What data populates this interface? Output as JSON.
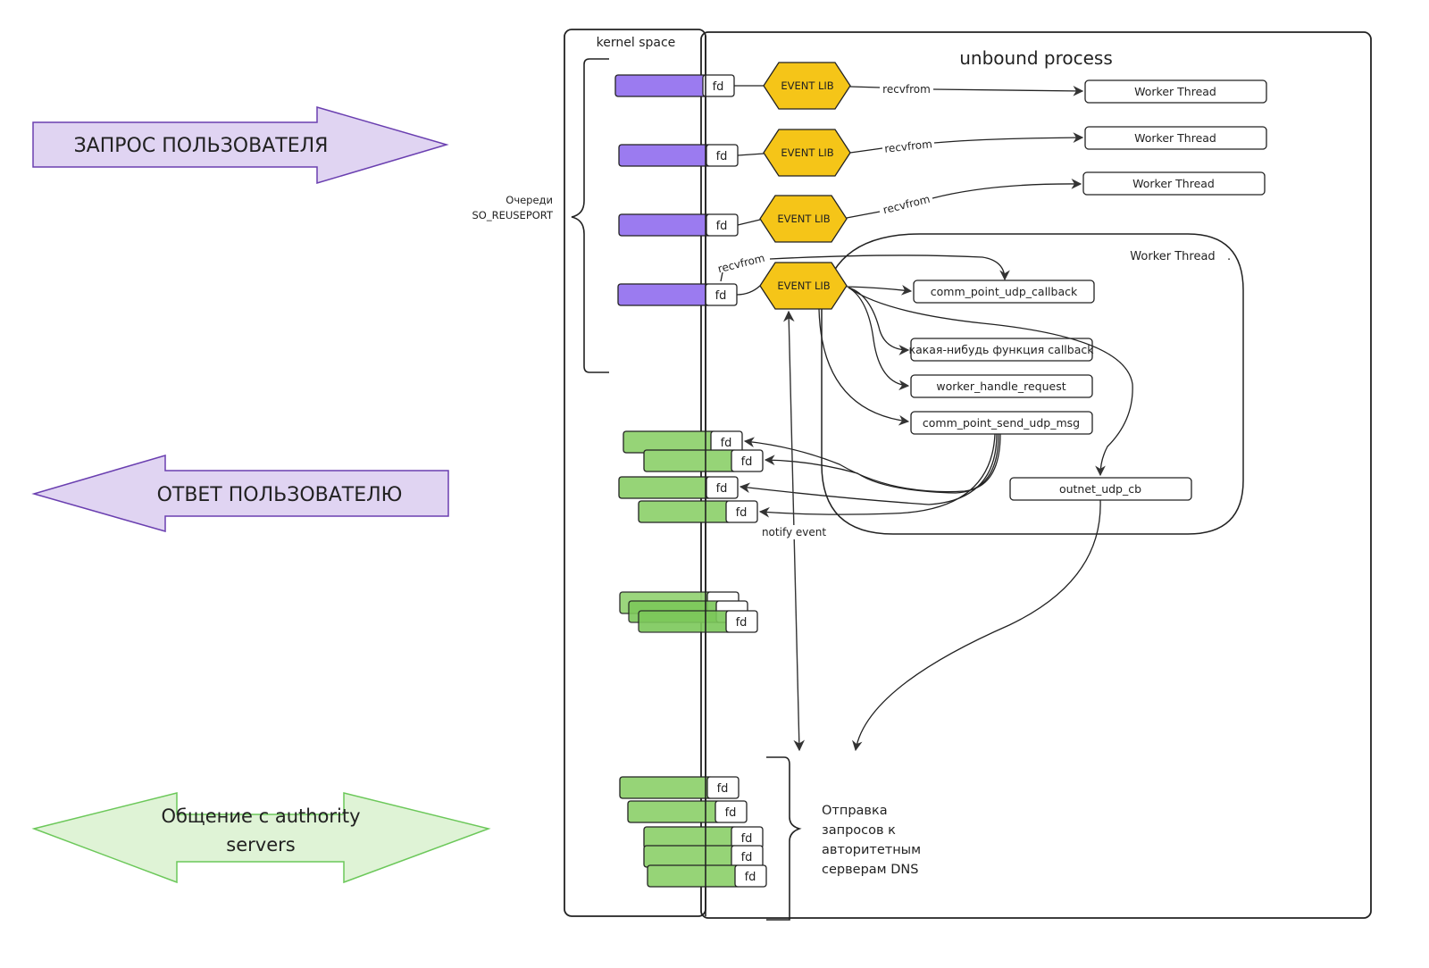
{
  "colors": {
    "queue_purple": "#9b7bf0",
    "request_arrow_fill": "#e0d4f2",
    "request_arrow_stroke": "#6a3fb0",
    "event_lib_fill": "#f5c518",
    "fd_green": "#96d477",
    "authority_arrow_fill": "#dff3d6",
    "authority_arrow_stroke": "#6cc85a",
    "line": "#222222"
  },
  "arrows": {
    "user_request": "ЗАПРОС ПОЛЬЗОВАТЕЛЯ",
    "user_response": "ОТВЕТ ПОЛЬЗОВАТЕЛЮ",
    "authority_line1": "Общение с authority",
    "authority_line2": "servers"
  },
  "kernel": {
    "title": "kernel space",
    "queues_label_line1": "Очереди",
    "queues_label_line2": "SO_REUSEPORT"
  },
  "process": {
    "title": "unbound process",
    "fd_label": "fd",
    "event_lib": "EVENT LIB",
    "recvfrom": "recvfrom",
    "worker_thread": "Worker Thread",
    "inner_worker_title": "Worker Thread",
    "inner_worker_dot": ".",
    "functions": {
      "udp_callback": "comm_point_udp_callback",
      "any_callback": "какая-нибудь функция callback",
      "handle_request": "worker_handle_request",
      "send_udp_msg": "comm_point_send_udp_msg",
      "outnet_cb": "outnet_udp_cb"
    },
    "notify_event": "notify event",
    "dns_send_line1": "Отправка",
    "dns_send_line2": "запросов к",
    "dns_send_line3": "авторитетным",
    "dns_send_line4": "серверам DNS"
  }
}
